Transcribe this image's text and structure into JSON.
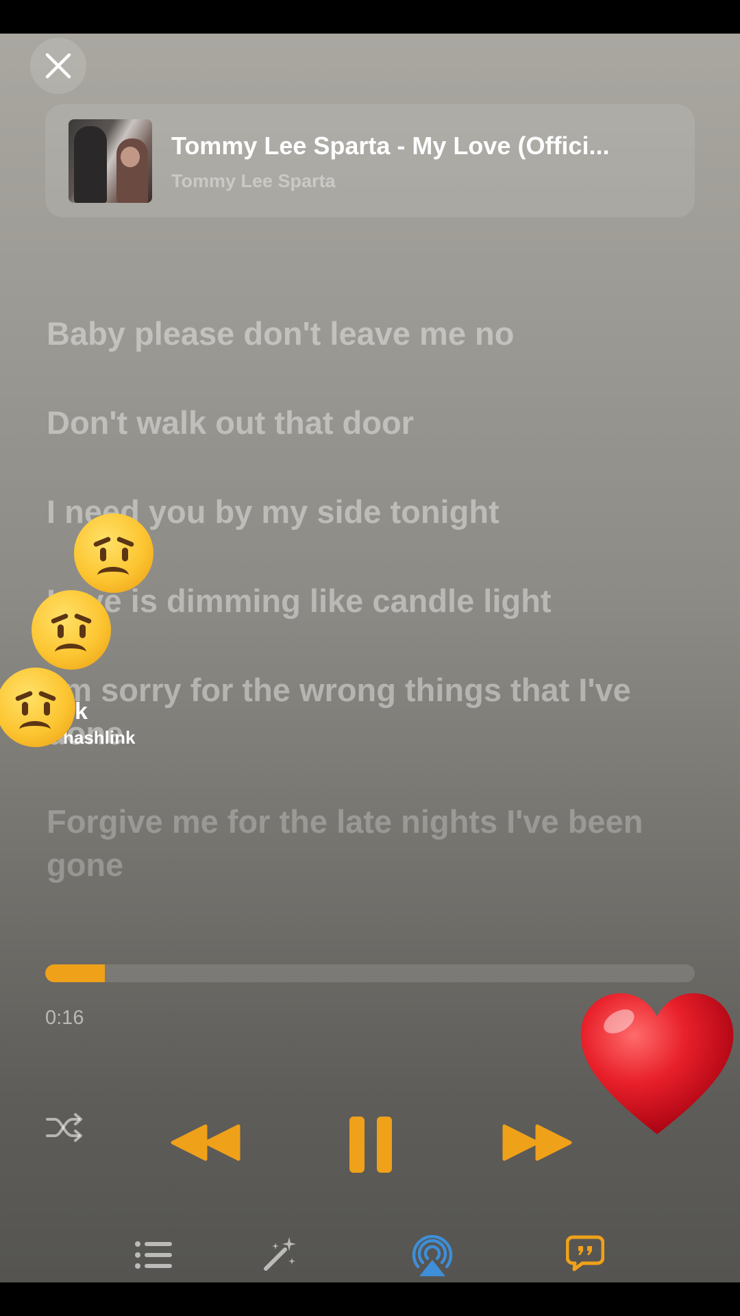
{
  "now_playing": {
    "title": "Tommy Lee Sparta - My Love (Offici...",
    "artist": "Tommy Lee Sparta"
  },
  "lyrics": [
    {
      "text": "Baby please don't leave me no"
    },
    {
      "text": "Don't walk out that door"
    },
    {
      "text": "I need you by my side tonight"
    },
    {
      "text": "Love is dimming like candle light"
    },
    {
      "text": "I'm sorry for the wrong things that I've done"
    },
    {
      "text": "Forgive me for the late nights I've been gone"
    }
  ],
  "playback": {
    "elapsed": "0:16",
    "progress_fraction": 0.092,
    "state": "playing"
  },
  "colors": {
    "accent": "#f0a11a",
    "airplay": "#3e8ed8"
  },
  "controls": {
    "icons": [
      "shuffle-icon",
      "rewind-icon",
      "pause-icon",
      "fast-forward-icon"
    ]
  },
  "bottom_bar": {
    "icons": [
      "queue-list-icon",
      "magic-wand-icon",
      "airplay-icon",
      "lyrics-bubble-icon"
    ]
  },
  "overlay": {
    "watermark_logo": "Tok",
    "watermark_user": "hashlink"
  }
}
